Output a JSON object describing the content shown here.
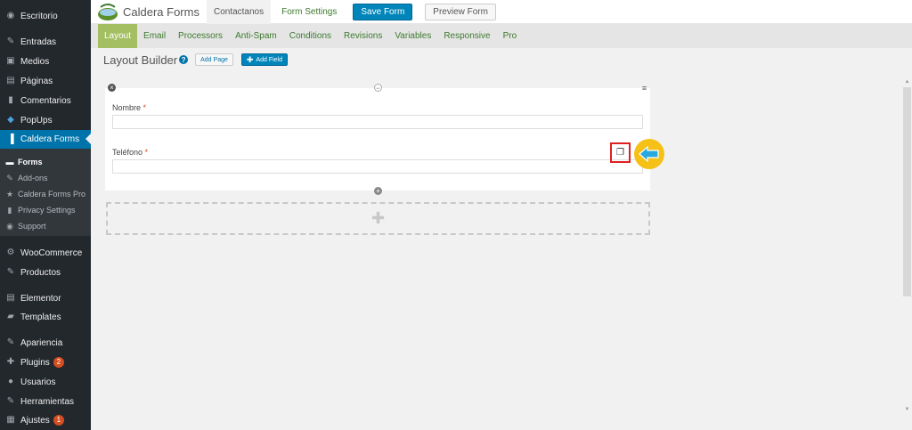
{
  "sidebar": {
    "items": [
      {
        "label": "Escritorio",
        "icon": "dashboard-icon"
      },
      {
        "label": "Entradas",
        "icon": "pin-icon"
      },
      {
        "label": "Medios",
        "icon": "media-icon"
      },
      {
        "label": "Páginas",
        "icon": "pages-icon"
      },
      {
        "label": "Comentarios",
        "icon": "comments-icon"
      },
      {
        "label": "PopUps",
        "icon": "popups-icon"
      },
      {
        "label": "Caldera Forms",
        "icon": "caldera-icon"
      },
      {
        "label": "WooCommerce",
        "icon": "gear-icon"
      },
      {
        "label": "Productos",
        "icon": "pin-icon"
      },
      {
        "label": "Elementor",
        "icon": "elementor-icon"
      },
      {
        "label": "Templates",
        "icon": "folder-icon"
      },
      {
        "label": "Apariencia",
        "icon": "brush-icon"
      },
      {
        "label": "Plugins",
        "icon": "plugin-icon",
        "badge": "2"
      },
      {
        "label": "Usuarios",
        "icon": "user-icon"
      },
      {
        "label": "Herramientas",
        "icon": "wrench-icon"
      },
      {
        "label": "Ajustes",
        "icon": "settings-icon",
        "badge": "1"
      }
    ],
    "submenu": [
      {
        "label": "Forms",
        "icon": "forms-icon"
      },
      {
        "label": "Add-ons",
        "icon": "addons-icon"
      },
      {
        "label": "Caldera Forms Pro",
        "icon": "star-icon"
      },
      {
        "label": "Privacy Settings",
        "icon": "privacy-icon"
      },
      {
        "label": "Support",
        "icon": "support-icon"
      }
    ]
  },
  "header": {
    "app_title": "Caldera Forms",
    "form_name": "Contactanos",
    "form_settings": "Form Settings",
    "save_label": "Save Form",
    "preview_label": "Preview Form"
  },
  "tabs": [
    "Layout",
    "Email",
    "Processors",
    "Anti-Spam",
    "Conditions",
    "Revisions",
    "Variables",
    "Responsive",
    "Pro"
  ],
  "builder": {
    "title": "Layout Builder",
    "help": "?",
    "add_page": "Add Page",
    "add_field": "Add Field"
  },
  "fields": [
    {
      "label": "Nombre",
      "required": "*"
    },
    {
      "label": "Teléfono",
      "required": "*"
    }
  ],
  "colors": {
    "sidebar_bg": "#23282d",
    "wp_blue": "#0073aa",
    "caldera_green": "#a3bf61",
    "callout_yellow": "#f5c116",
    "highlight_red": "#e02020"
  }
}
